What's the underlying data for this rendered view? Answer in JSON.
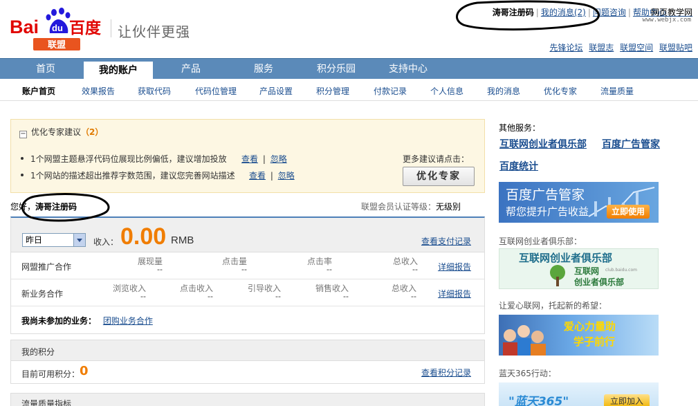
{
  "logo": {
    "text_bai": "Bai",
    "text_du": "du",
    "text_baidu": "百度",
    "text_lianmeng": "联盟"
  },
  "slogan": "让伙伴更强",
  "top_links": {
    "user": "涛哥注册码",
    "messages": "我的消息",
    "messages_count": "(2)",
    "consult": "问题咨询",
    "help": "帮助中心",
    "overlay": "网页教学网"
  },
  "watermark": "www.webjx.com",
  "sub_links": [
    "先锋论坛",
    "联盟志",
    "联盟空间",
    "联盟贴吧"
  ],
  "main_nav": [
    "首页",
    "我的账户",
    "产品",
    "服务",
    "积分乐园",
    "支持中心"
  ],
  "sub_nav": [
    "账户首页",
    "效果报告",
    "获取代码",
    "代码位管理",
    "产品设置",
    "积分管理",
    "付款记录",
    "个人信息",
    "我的消息",
    "优化专家",
    "流量质量"
  ],
  "suggest": {
    "title": "优化专家建议",
    "count": "（2）",
    "items": [
      {
        "text": "1个网盟主题悬浮代码位展现比例偏低，建议增加投放",
        "view": "查看",
        "ignore": "忽略"
      },
      {
        "text": "1个网站的描述超出推荐字数范围，建议您完善网站描述",
        "view": "查看",
        "ignore": "忽略"
      }
    ],
    "more_tip": "更多建议请点击：",
    "button": "优化专家",
    "sep": "|"
  },
  "greeting": {
    "prefix": "您好，",
    "user": "涛哥注册码"
  },
  "level": {
    "label": "联盟会员认证等级：",
    "value": "无级别"
  },
  "income": {
    "period": "昨日",
    "label": "收入：",
    "value": "0.00",
    "unit": "RMB",
    "pay_record": "查看支付记录",
    "rows": [
      {
        "title": "网盟推广合作",
        "metrics": [
          {
            "label": "展现量",
            "value": "--"
          },
          {
            "label": "点击量",
            "value": "--"
          },
          {
            "label": "点击率",
            "value": "--"
          },
          {
            "label": "总收入",
            "value": "--"
          }
        ],
        "detail": "详细报告"
      },
      {
        "title": "新业务合作",
        "metrics": [
          {
            "label": "浏览收入",
            "value": "--"
          },
          {
            "label": "点击收入",
            "value": "--"
          },
          {
            "label": "引导收入",
            "value": "--"
          },
          {
            "label": "销售收入",
            "value": "--"
          },
          {
            "label": "总收入",
            "value": "--"
          }
        ],
        "detail": "详细报告"
      }
    ],
    "not_joined_label": "我尚未参加的业务：",
    "not_joined_link": "团购业务合作"
  },
  "points": {
    "title": "我的积分",
    "label": "目前可用积分：",
    "value": "0",
    "record": "查看积分记录"
  },
  "quality": {
    "title": "流量质量指标"
  },
  "side": {
    "title": "其他服务：",
    "links": [
      "互联网创业者俱乐部",
      "百度广告管家",
      "百度统计"
    ],
    "banner1": {
      "title": "百度广告管家",
      "subtitle": "帮您提升广告收益",
      "button": "立即使用"
    },
    "caption2": "互联网创业者俱乐部：",
    "banner2": {
      "title": "互联网创业者俱乐部",
      "brand1": "互联网",
      "brand2": "创业者俱乐部",
      "url": "club.baidu.com"
    },
    "caption3": "让爱心联网，托起新的希望：",
    "banner3": {
      "line1": "爱心力量助",
      "line2": "学子前行"
    },
    "caption4": "蓝天365行动：",
    "banner4": {
      "title": "\"蓝天365\"",
      "button": "立即加入"
    }
  },
  "colors": {
    "nav_blue": "#5b8ab9",
    "orange": "#f07d00",
    "link": "#1a4d8f",
    "logo_red": "#e10602",
    "logo_blue": "#2319dc"
  }
}
